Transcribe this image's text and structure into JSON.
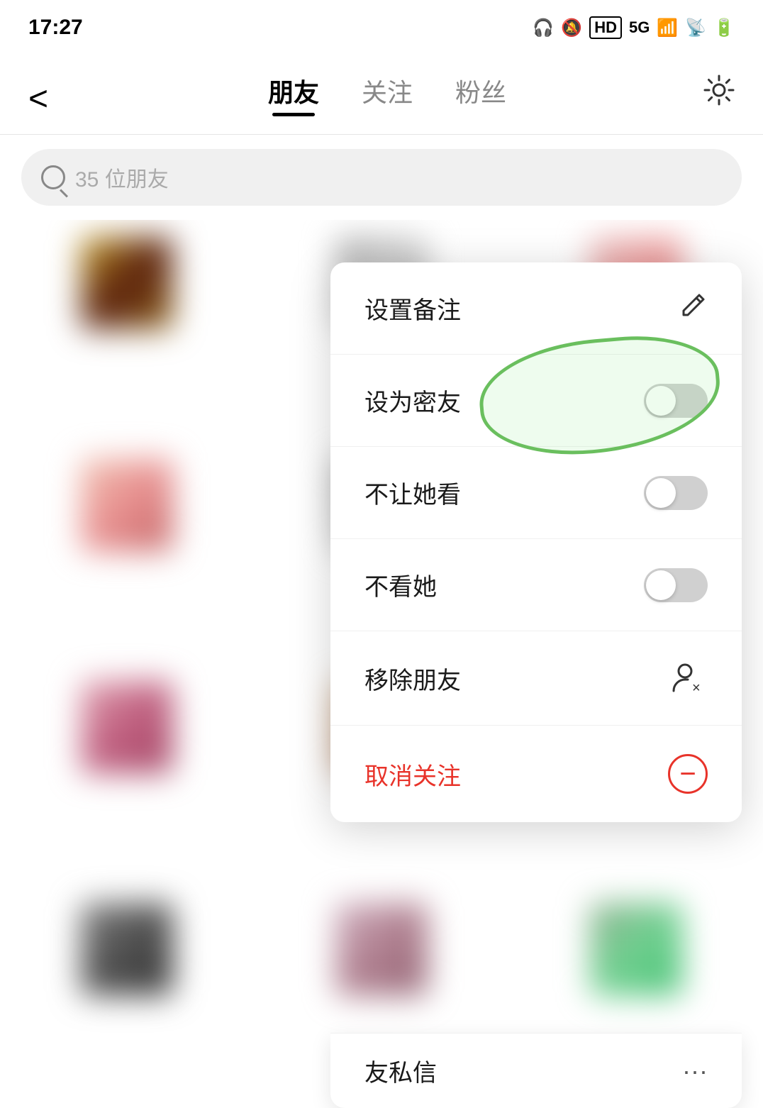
{
  "statusBar": {
    "time": "17:27",
    "icons": [
      "🎧",
      "🔕",
      "HD",
      "5G",
      "📶",
      "🔋"
    ]
  },
  "navBar": {
    "backLabel": "‹",
    "tabs": [
      {
        "label": "朋友",
        "active": true
      },
      {
        "label": "关注",
        "active": false
      },
      {
        "label": "粉丝",
        "active": false
      }
    ],
    "settingsLabel": "⚙"
  },
  "searchBar": {
    "placeholder": "35 位朋友"
  },
  "contextMenu": {
    "items": [
      {
        "id": "set-note",
        "label": "设置备注",
        "icon": "edit",
        "type": "icon"
      },
      {
        "id": "set-close-friend",
        "label": "设为密友",
        "icon": "toggle",
        "type": "toggle",
        "highlighted": true
      },
      {
        "id": "block-see",
        "label": "不让她看",
        "icon": "toggle",
        "type": "toggle"
      },
      {
        "id": "block-her",
        "label": "不看她",
        "icon": "toggle",
        "type": "toggle"
      },
      {
        "id": "remove-friend",
        "label": "移除朋友",
        "icon": "remove",
        "type": "remove"
      },
      {
        "id": "unfollow",
        "label": "取消关注",
        "icon": "minus-circle",
        "type": "unfollow",
        "red": true
      }
    ]
  },
  "partialItem": {
    "label": "友私信",
    "icon": "···"
  }
}
